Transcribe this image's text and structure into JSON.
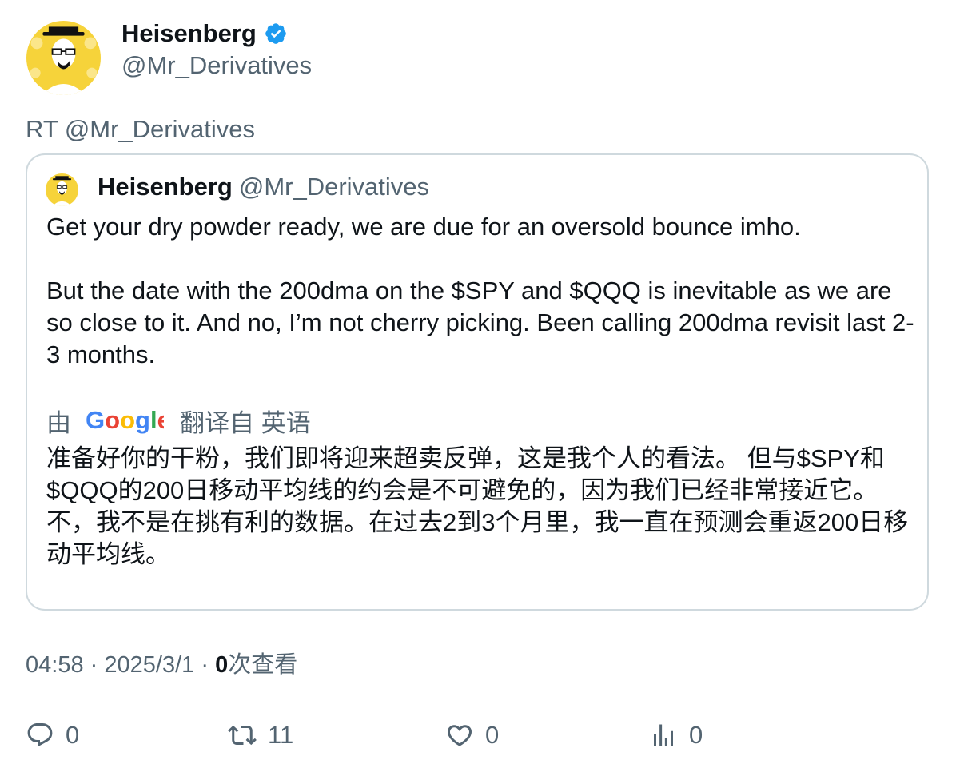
{
  "author": {
    "name": "Heisenberg",
    "handle": "@Mr_Derivatives",
    "verified_color": "#1d9bf0"
  },
  "retweet_line": "RT @Mr_Derivatives",
  "quoted": {
    "name": "Heisenberg",
    "handle": "@Mr_Derivatives",
    "paragraph_1": "Get your dry powder ready, we are due for an oversold bounce imho.",
    "paragraph_2": "But the date with the 200dma on the $SPY and $QQQ is inevitable as we are so close to it. And no, I’m not cherry picking. Been calling 200dma revisit last 2-3 months.",
    "translation": {
      "prefix": "由",
      "brand": "Google",
      "suffix": "翻译自 英语",
      "text": "准备好你的干粉，我们即将迎来超卖反弹，这是我个人的看法。 但与$SPY和$QQQ的200日移动平均线的约会是不可避免的，因为我们已经非常接近它。不，我不是在挑有利的数据。在过去2到3个月里，我一直在预测会重返200日移动平均线。"
    }
  },
  "meta": {
    "time": "04:58",
    "separator": "·",
    "date": "2025/3/1",
    "views_count": "0",
    "views_label": "次查看"
  },
  "actions": {
    "replies": "0",
    "retweets": "11",
    "likes": "0",
    "views": "0"
  },
  "colors": {
    "text": "#0f1419",
    "secondary": "#536471",
    "border": "#cfd9de",
    "avatar_bg": "#f6d33a"
  }
}
